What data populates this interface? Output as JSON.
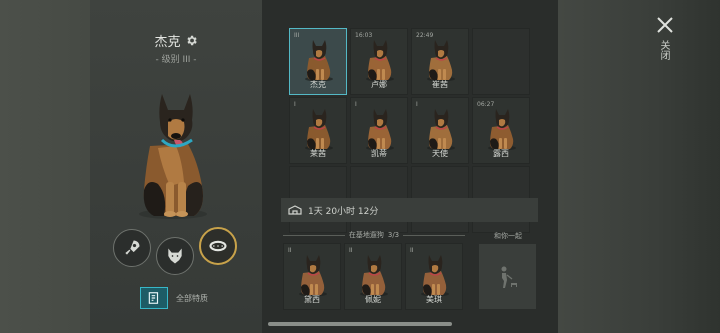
{
  "dog": {
    "name": "杰克",
    "level": "- 级别 III -"
  },
  "traits": [
    {
      "icon": "rocket-icon"
    },
    {
      "icon": "wolf-icon"
    },
    {
      "icon": "collar-icon",
      "active": true
    }
  ],
  "all_traits_label": "全部特质",
  "kennel": {
    "slots": [
      {
        "badge": "III",
        "name": "杰克",
        "selected": true
      },
      {
        "badge": "16:03",
        "name": "卢娜"
      },
      {
        "badge": "22:49",
        "name": "崔茜"
      },
      {
        "badge": "",
        "name": "",
        "empty": true
      },
      {
        "badge": "I",
        "name": "莱茜"
      },
      {
        "badge": "I",
        "name": "凯蒂"
      },
      {
        "badge": "I",
        "name": "天使"
      },
      {
        "badge": "06:27",
        "name": "露西"
      },
      {
        "badge": "",
        "name": "",
        "empty": true
      },
      {
        "badge": "",
        "name": "",
        "empty": true
      },
      {
        "badge": "",
        "name": "",
        "empty": true
      },
      {
        "badge": "",
        "name": "",
        "empty": true
      }
    ],
    "timer": "1天 20小时 12分"
  },
  "at_base": {
    "label": "在基地遛狗",
    "count": "3/3",
    "dogs": [
      {
        "badge": "II",
        "name": "黛西"
      },
      {
        "badge": "II",
        "name": "佩妮"
      },
      {
        "badge": "II",
        "name": "美琪"
      }
    ]
  },
  "with_you_label": "和你一起",
  "close_label": "关闭"
}
